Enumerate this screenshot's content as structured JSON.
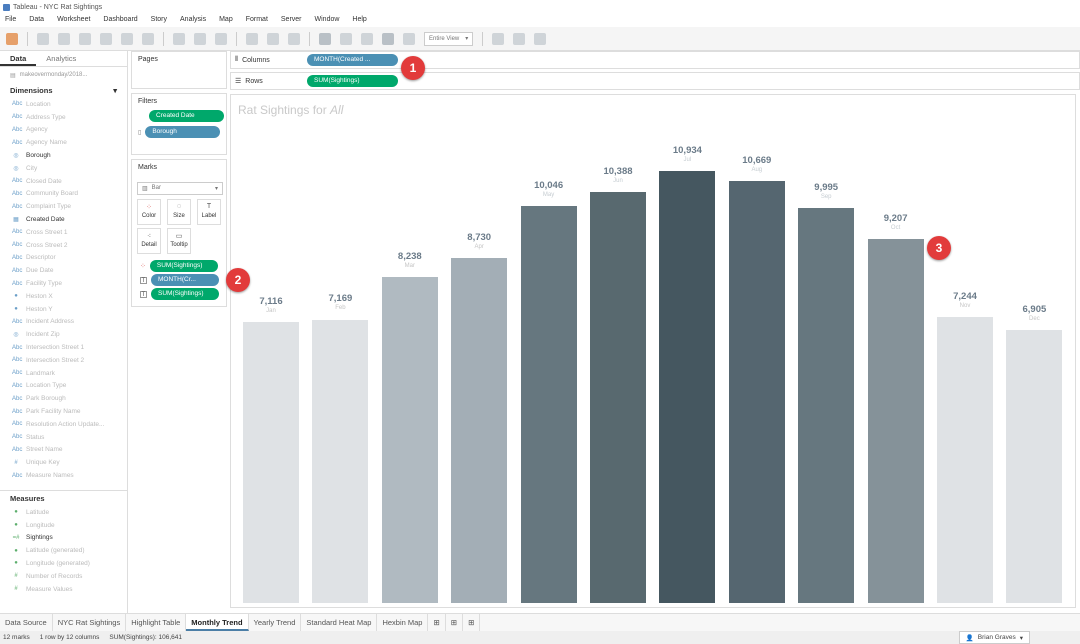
{
  "window": {
    "title": "Tableau - NYC Rat Sightings"
  },
  "menu": [
    "File",
    "Data",
    "Worksheet",
    "Dashboard",
    "Story",
    "Analysis",
    "Map",
    "Format",
    "Server",
    "Window",
    "Help"
  ],
  "toolbar": {
    "fit_label": "Entire View"
  },
  "sidebar": {
    "tabs": [
      "Data",
      "Analytics"
    ],
    "datasource": "makeovermonday/2018...",
    "dimensions_header": "Dimensions",
    "dimensions": [
      {
        "label": "Location",
        "icon": "Abc"
      },
      {
        "label": "Address Type",
        "icon": "Abc"
      },
      {
        "label": "Agency",
        "icon": "Abc"
      },
      {
        "label": "Agency Name",
        "icon": "Abc"
      },
      {
        "label": "Borough",
        "icon": "◎",
        "bright": true
      },
      {
        "label": "City",
        "icon": "◎"
      },
      {
        "label": "Closed Date",
        "icon": "Abc"
      },
      {
        "label": "Community Board",
        "icon": "Abc"
      },
      {
        "label": "Complaint Type",
        "icon": "Abc"
      },
      {
        "label": "Created Date",
        "icon": "▦",
        "bright": true
      },
      {
        "label": "Cross Street 1",
        "icon": "Abc"
      },
      {
        "label": "Cross Street 2",
        "icon": "Abc"
      },
      {
        "label": "Descriptor",
        "icon": "Abc"
      },
      {
        "label": "Due Date",
        "icon": "Abc"
      },
      {
        "label": "Facility Type",
        "icon": "Abc"
      },
      {
        "label": "Heston X",
        "icon": "●"
      },
      {
        "label": "Heston Y",
        "icon": "●"
      },
      {
        "label": "Incident Address",
        "icon": "Abc"
      },
      {
        "label": "Incident Zip",
        "icon": "◎"
      },
      {
        "label": "Intersection Street 1",
        "icon": "Abc"
      },
      {
        "label": "Intersection Street 2",
        "icon": "Abc"
      },
      {
        "label": "Landmark",
        "icon": "Abc"
      },
      {
        "label": "Location Type",
        "icon": "Abc"
      },
      {
        "label": "Park Borough",
        "icon": "Abc"
      },
      {
        "label": "Park Facility Name",
        "icon": "Abc"
      },
      {
        "label": "Resolution Action Update...",
        "icon": "Abc"
      },
      {
        "label": "Status",
        "icon": "Abc"
      },
      {
        "label": "Street Name",
        "icon": "Abc"
      },
      {
        "label": "Unique Key",
        "icon": "#"
      },
      {
        "label": "Measure Names",
        "icon": "Abc"
      }
    ],
    "measures_header": "Measures",
    "measures": [
      {
        "label": "Latitude",
        "icon": "●"
      },
      {
        "label": "Longitude",
        "icon": "●"
      },
      {
        "label": "Sightings",
        "icon": "=#",
        "bright": true
      },
      {
        "label": "Latitude (generated)",
        "icon": "●"
      },
      {
        "label": "Longitude (generated)",
        "icon": "●"
      },
      {
        "label": "Number of Records",
        "icon": "#"
      },
      {
        "label": "Measure Values",
        "icon": "#"
      }
    ]
  },
  "cards": {
    "pages": "Pages",
    "filters": "Filters",
    "filter_pills": [
      "Created Date",
      "Borough"
    ],
    "marks": "Marks",
    "mark_type": "Bar",
    "mark_buttons": [
      "Color",
      "Size",
      "Label",
      "Detail",
      "Tooltip"
    ],
    "mark_pills": [
      "SUM(Sightings)",
      "MONTH(Cr...",
      "SUM(Sightings)"
    ]
  },
  "shelves": {
    "columns_label": "Columns",
    "columns_pill": "MONTH(Created ...",
    "rows_label": "Rows",
    "rows_pill": "SUM(Sightings)"
  },
  "view": {
    "title_prefix": "Rat Sightings for ",
    "title_italic": "All"
  },
  "badges": [
    "1",
    "2",
    "3"
  ],
  "colors": {
    "accent": "#4b7ea6",
    "green_pill": "#00a86b",
    "blue_pill": "#4b90b4",
    "badge": "#e23b3b"
  },
  "chart_data": {
    "type": "bar",
    "categories": [
      "Jan",
      "Feb",
      "Mar",
      "Apr",
      "May",
      "Jun",
      "Jul",
      "Aug",
      "Sep",
      "Oct",
      "Nov",
      "Dec"
    ],
    "values": [
      7116,
      7169,
      8238,
      8730,
      10046,
      10388,
      10934,
      10669,
      9995,
      9207,
      7244,
      6905
    ],
    "value_labels": [
      "7,116",
      "7,169",
      "8,238",
      "8,730",
      "10,046",
      "10,388",
      "10,934",
      "10,669",
      "9,995",
      "9,207",
      "7,244",
      "6,905"
    ],
    "colors": [
      "#dfe2e5",
      "#dfe2e5",
      "#b0bac1",
      "#a3aeb6",
      "#66777f",
      "#58696f",
      "#455760",
      "#556670",
      "#66777f",
      "#859299",
      "#dfe2e5",
      "#dfe2e5"
    ],
    "title": "Rat Sightings for All",
    "grid": false,
    "axes_visible": false
  },
  "sheet_tabs": [
    "Data Source",
    "NYC Rat Sightings",
    "Highlight Table",
    "Monthly Trend",
    "Yearly Trend",
    "Standard Heat Map",
    "Hexbin Map"
  ],
  "status": {
    "marks": "12 marks",
    "rows": "1 row by 12 columns",
    "sum": "SUM(Sightings): 106,641",
    "user": "Brian Graves"
  }
}
